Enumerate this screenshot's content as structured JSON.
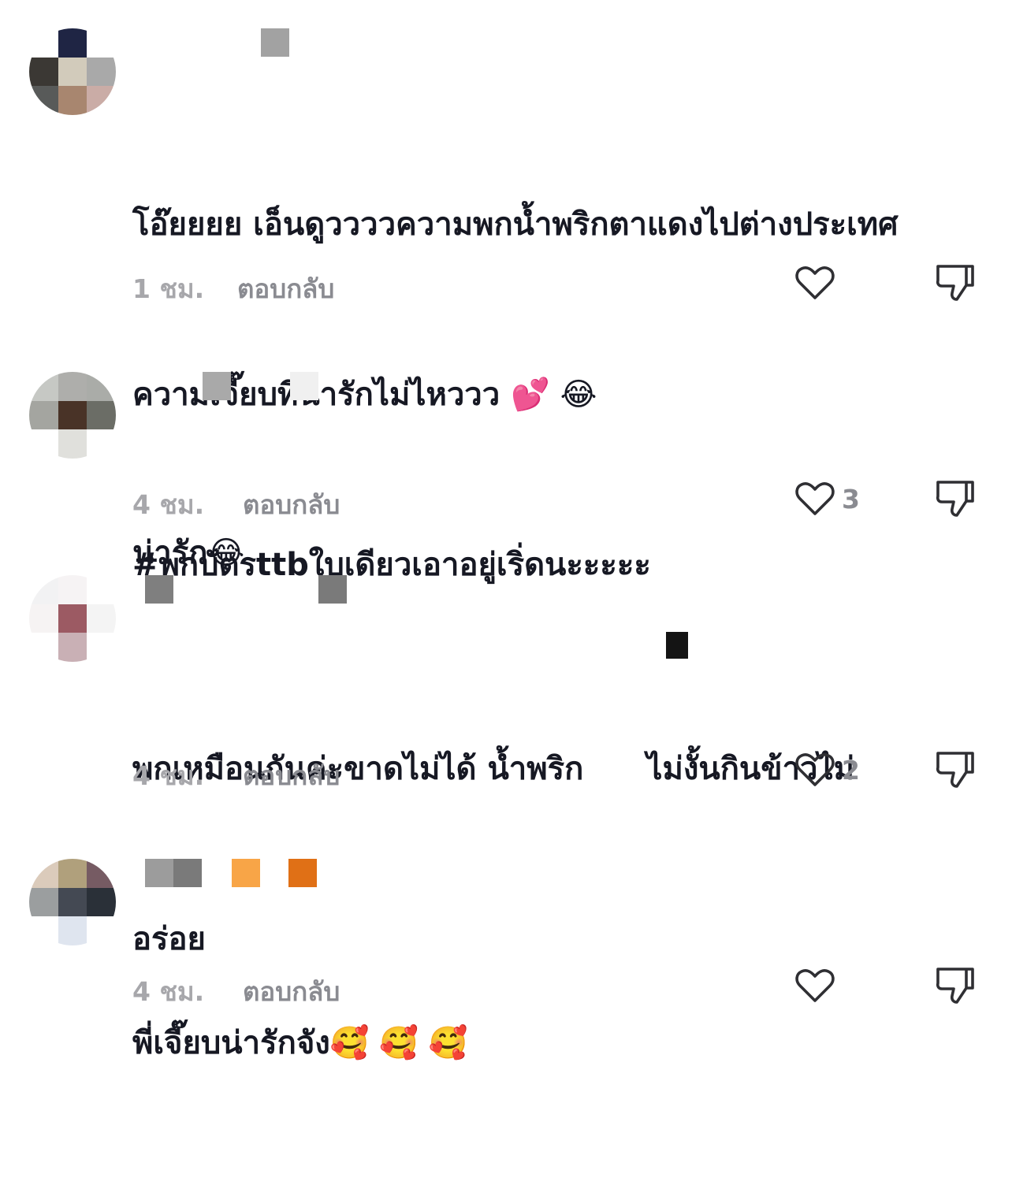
{
  "comments": [
    {
      "text_line1": "โอ๊ยยยย เอ็นดูววววความพกน้ำพริกตาแดงไปต่างประเทศ",
      "text_line2": "ความเจี๊ยบที่น่ารักไม่ไหววว",
      "text_line2_emoji": "💕 😂",
      "text_line3": "#พกบัตรttbใบเดียวเอาอยู่เริ่ดนะะะะะ",
      "time": "1 ชม.",
      "reply": "ตอบกลับ",
      "like_count": ""
    },
    {
      "text_line1": "น่ารัก",
      "text_line1_emoji": "😂",
      "time": "4 ชม.",
      "reply": "ตอบกลับ",
      "like_count": "3"
    },
    {
      "text_line1a": "พกเหมือนกันค่ะขาดไม่ได้ น้ำพริก",
      "text_line1b": "ไม่งั้นกินข้าวไม่",
      "text_line2": "อร่อย",
      "time": "4 ชม.",
      "reply": "ตอบกลับ",
      "like_count": "2"
    },
    {
      "text_line1": "พี่เจี๊ยบน่ารักจัง",
      "text_line1_emoji": "🥰 🥰 🥰",
      "time": "4 ชม.",
      "reply": "ตอบกลับ",
      "like_count": ""
    }
  ],
  "icons": {
    "like": "heart-outline-icon",
    "dislike": "thumbs-down-outline-icon"
  },
  "colors": {
    "text": "#161823",
    "meta": "#8a8b91",
    "time": "#a7a7ab"
  }
}
